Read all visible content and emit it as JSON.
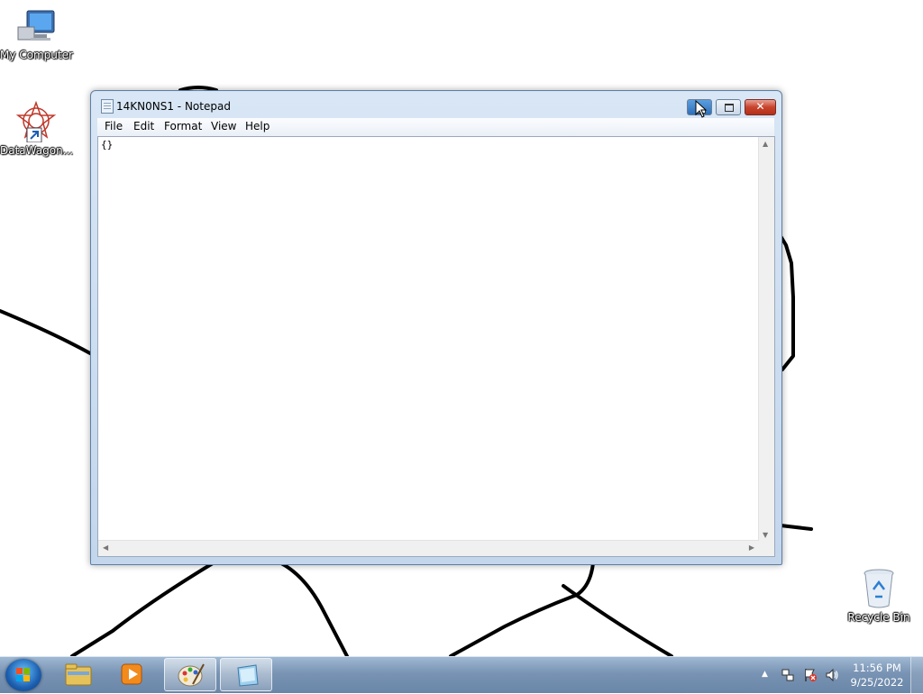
{
  "desktop": {
    "icons": [
      {
        "label": "My Computer"
      },
      {
        "label": "DataWagon..."
      },
      {
        "label": "Recycle Bin"
      }
    ]
  },
  "notepad": {
    "title": "14KN0NS1 - Notepad",
    "menu": [
      "File",
      "Edit",
      "Format",
      "View",
      "Help"
    ],
    "content": "{}",
    "controls": {
      "close_glyph": "✕"
    }
  },
  "taskbar": {
    "pinned": [
      "start-orb",
      "explorer-icon",
      "media-player-icon",
      "paint-icon",
      "notepad-icon"
    ],
    "tray": {
      "time": "11:56 PM",
      "date": "9/25/2022"
    }
  }
}
